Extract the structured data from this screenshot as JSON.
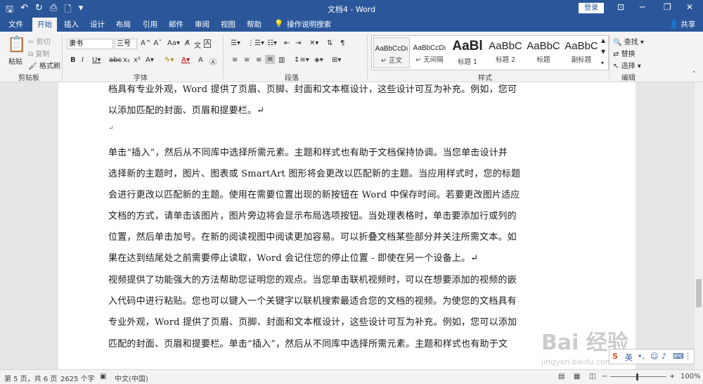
{
  "window": {
    "title": "文档4  -  Word",
    "login": "登录"
  },
  "tabs": [
    "文件",
    "开始",
    "插入",
    "设计",
    "布局",
    "引用",
    "邮件",
    "审阅",
    "视图",
    "帮助",
    "操作说明搜索"
  ],
  "share": "共享",
  "clipboard": {
    "paste": "粘贴",
    "cut": "剪切",
    "copy": "复制",
    "format_painter": "格式刷",
    "label": "剪贴板"
  },
  "font": {
    "name": "隶书",
    "size": "三号",
    "grow": "A",
    "label": "字体"
  },
  "paragraph": {
    "label": "段落"
  },
  "styles": {
    "label": "样式",
    "items": [
      {
        "preview": "AaBbCcDı",
        "name": "↵ 正文"
      },
      {
        "preview": "AaBbCcDı",
        "name": "↵ 无间隔"
      },
      {
        "preview": "AaBl",
        "name": "标题 1"
      },
      {
        "preview": "AaBbC",
        "name": "标题 2"
      },
      {
        "preview": "AaBbC",
        "name": "标题"
      },
      {
        "preview": "AaBbC",
        "name": "副标题"
      }
    ]
  },
  "editing": {
    "find": "查找",
    "replace": "替换",
    "select": "选择",
    "label": "编辑"
  },
  "document": {
    "lines": [
      "档具有专业外观，Word 提供了页眉、页脚、封面和文本框设计，这些设计可互为补充。例如，您可",
      "以添加匹配的封面、页眉和提要栏。↵",
      "↵",
      "单击“插入”，然后从不同库中选择所需元素。主题和样式也有助于文档保持协调。当您单击设计并",
      "选择新的主题时，图片、图表或 SmartArt 图形将会更改以匹配新的主题。当应用样式时，您的标题",
      "会进行更改以匹配新的主题。使用在需要位置出现的新按钮在 Word 中保存时间。若要更改图片适应",
      "文档的方式，请单击该图片，图片旁边将会显示布局选项按钮。当处理表格时，单击要添加行或列的",
      "位置，然后单击加号。在新的阅读视图中阅读更加容易。可以折叠文档某些部分并关注所需文本。如",
      "果在达到结尾处之前需要停止读取，Word 会记住您的停止位置 - 即使在另一个设备上。↵",
      "视频提供了功能强大的方法帮助您证明您的观点。当您单击联机视频时，可以在想要添加的视频的嵌",
      "入代码中进行粘贴。您也可以键入一个关键字以联机搜索最适合您的文档的视频。为使您的文档具有",
      "专业外观，Word 提供了页眉、页脚、封面和文本框设计，这些设计可互为补充。例如，您可以添加",
      "匹配的封面、页眉和提要栏。单击“插入”，然后从不同库中选择所需元素。主题和样式也有助于文"
    ]
  },
  "ime": {
    "lang": "英"
  },
  "watermark": {
    "logo": "Bai 经验",
    "url": "jingyan.baidu.com"
  },
  "status": {
    "page": "第 5 页，共 6 页",
    "words": "2625 个字",
    "lang": "中文(中国)",
    "zoom": "100%"
  }
}
